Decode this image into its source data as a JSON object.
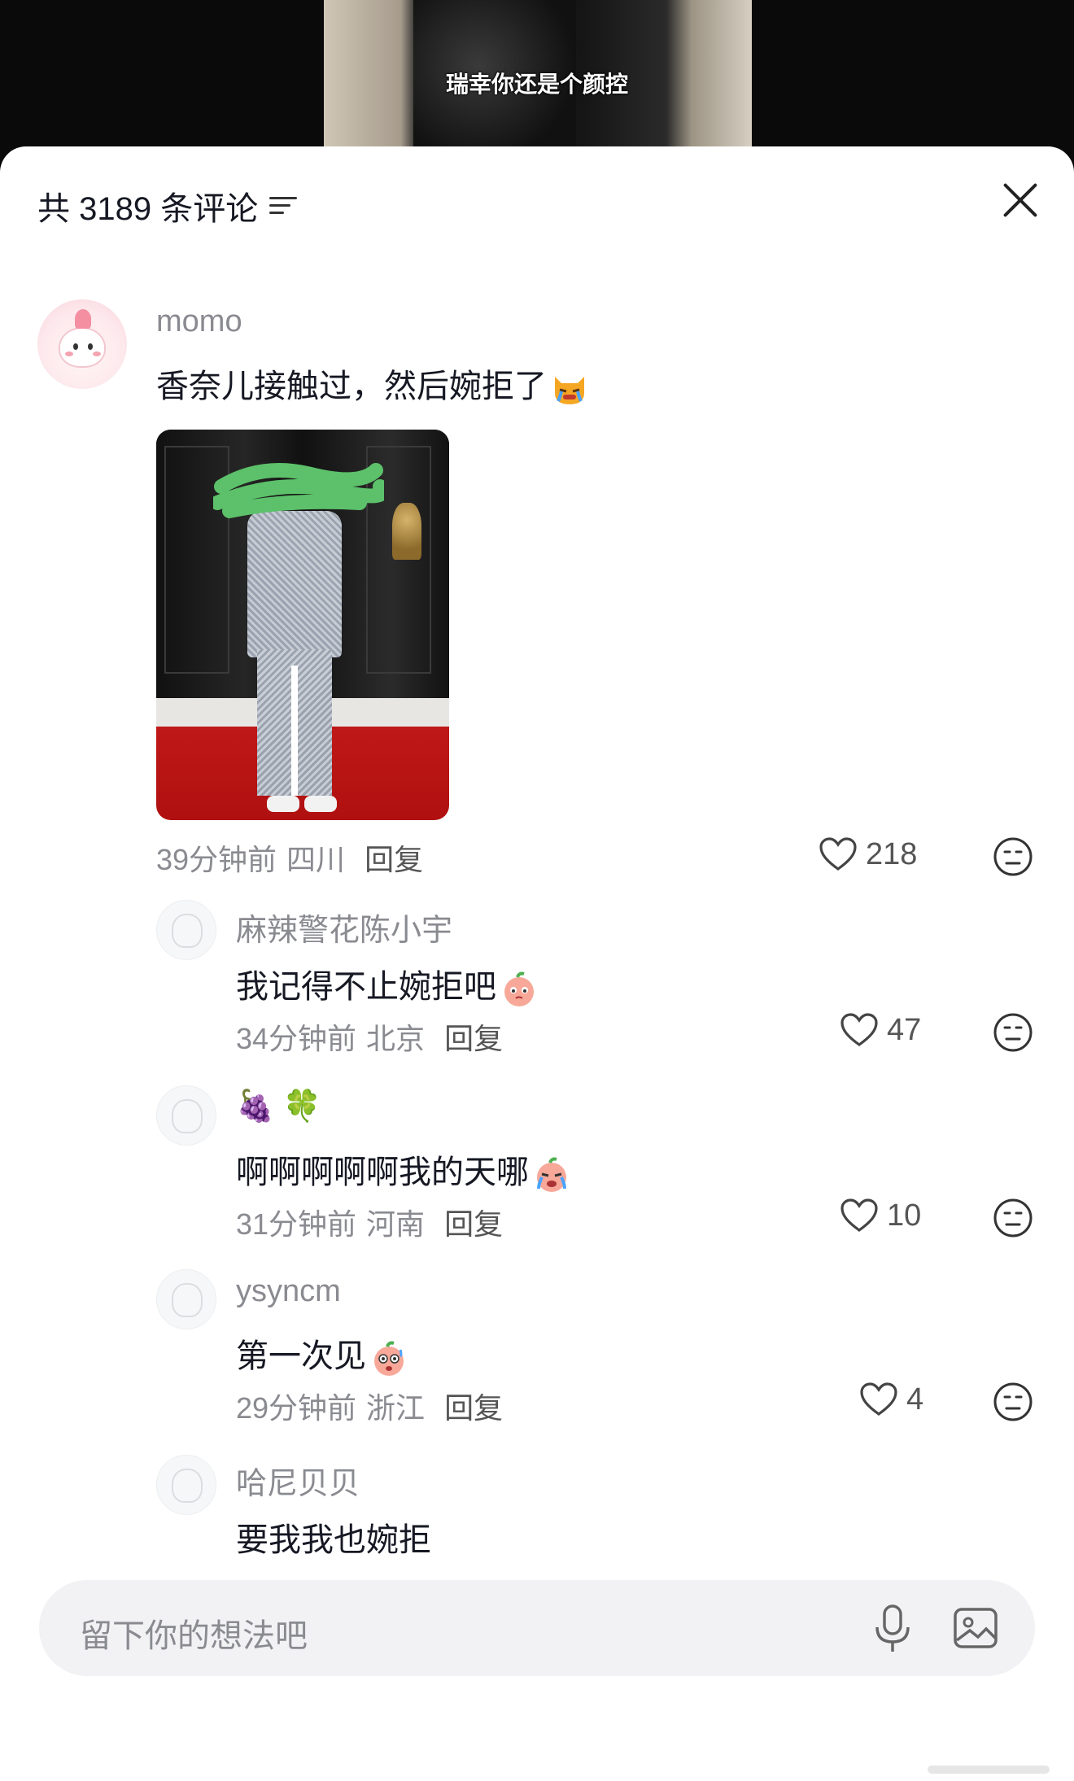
{
  "video": {
    "caption": "瑞幸你还是个颜控"
  },
  "header": {
    "comment_count_label": "共 3189 条评论",
    "filter_icon": "filter-lines-icon",
    "close_icon": "close-icon"
  },
  "main_comment": {
    "username": "momo",
    "text": "香奈儿接触过，然后婉拒了",
    "emoji": "crying-cat-emoji",
    "time": "39分钟前",
    "region": "四川",
    "reply_label": "回复",
    "likes": "218"
  },
  "replies": [
    {
      "username": "麻辣警花陈小宇",
      "text": "我记得不止婉拒吧",
      "emoji": "thinking-peach-emoji",
      "time": "34分钟前",
      "region": "北京",
      "reply_label": "回复",
      "likes": "47"
    },
    {
      "username": "🍇 🍀",
      "text": "啊啊啊啊啊我的天哪",
      "emoji": "crying-peach-emoji",
      "time": "31分钟前",
      "region": "河南",
      "reply_label": "回复",
      "likes": "10"
    },
    {
      "username": "ysyncm",
      "text": "第一次见",
      "emoji": "surprised-peach-emoji",
      "time": "29分钟前",
      "region": "浙江",
      "reply_label": "回复",
      "likes": "4"
    },
    {
      "username": "哈尼贝贝",
      "text": "要我我也婉拒"
    }
  ],
  "input": {
    "placeholder": "留下你的想法吧",
    "mic_icon": "microphone-icon",
    "image_icon": "image-icon"
  }
}
